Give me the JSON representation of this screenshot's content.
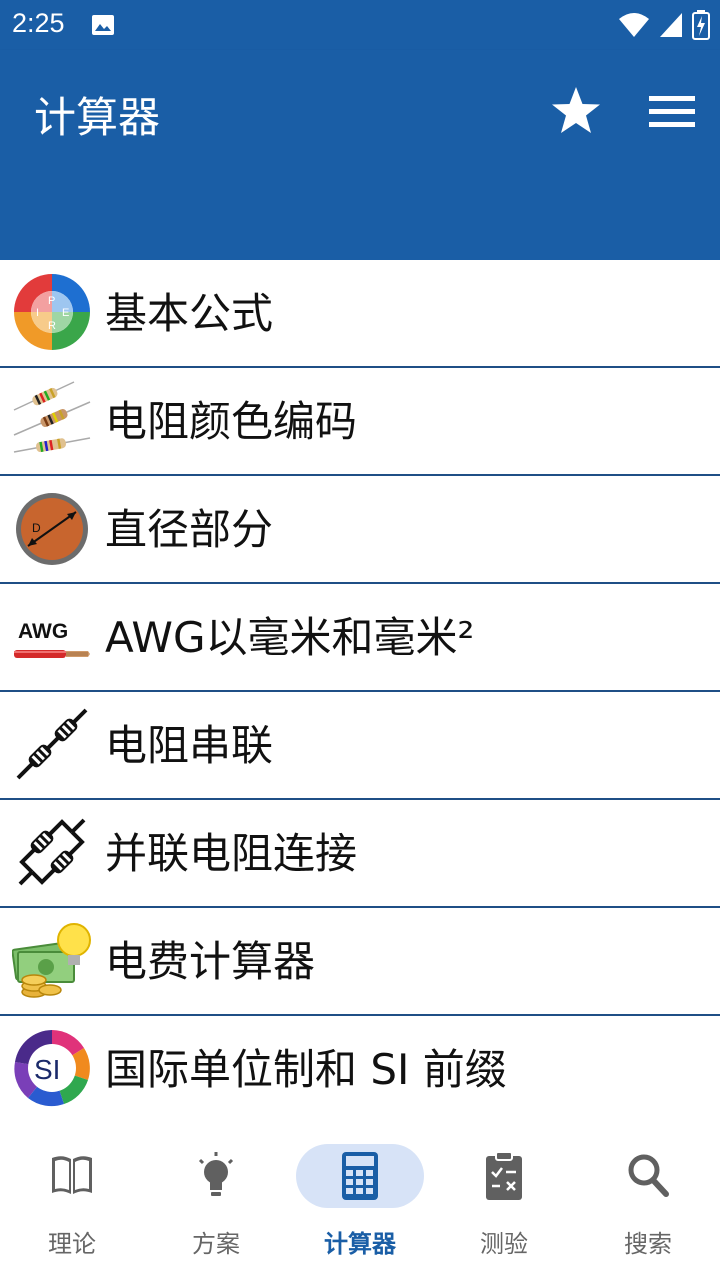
{
  "status_bar": {
    "time": "2:25"
  },
  "app_bar": {
    "title": "计算器"
  },
  "list": {
    "items": [
      {
        "label": "基本公式",
        "icon": "formula-wheel-icon"
      },
      {
        "label": "电阻颜色编码",
        "icon": "resistor-color-icon"
      },
      {
        "label": "直径部分",
        "icon": "wire-diameter-icon"
      },
      {
        "label": "AWG以毫米和毫米²",
        "icon": "awg-wire-icon",
        "icon_text": "AWG"
      },
      {
        "label": "电阻串联",
        "icon": "resistors-series-icon"
      },
      {
        "label": "并联电阻连接",
        "icon": "resistors-parallel-icon"
      },
      {
        "label": "电费计算器",
        "icon": "electricity-cost-icon"
      },
      {
        "label": "国际单位制和 SI 前缀",
        "icon": "si-units-icon",
        "icon_text": "SI"
      }
    ]
  },
  "bottom_nav": {
    "items": [
      {
        "label": "理论",
        "icon": "book-icon"
      },
      {
        "label": "方案",
        "icon": "lightbulb-icon"
      },
      {
        "label": "计算器",
        "icon": "calculator-icon",
        "active": true
      },
      {
        "label": "测验",
        "icon": "clipboard-check-icon"
      },
      {
        "label": "搜索",
        "icon": "search-icon"
      }
    ]
  },
  "colors": {
    "primary": "#1a5ea6",
    "active_pill": "#d7e3f7",
    "divider": "#1f4f86"
  }
}
